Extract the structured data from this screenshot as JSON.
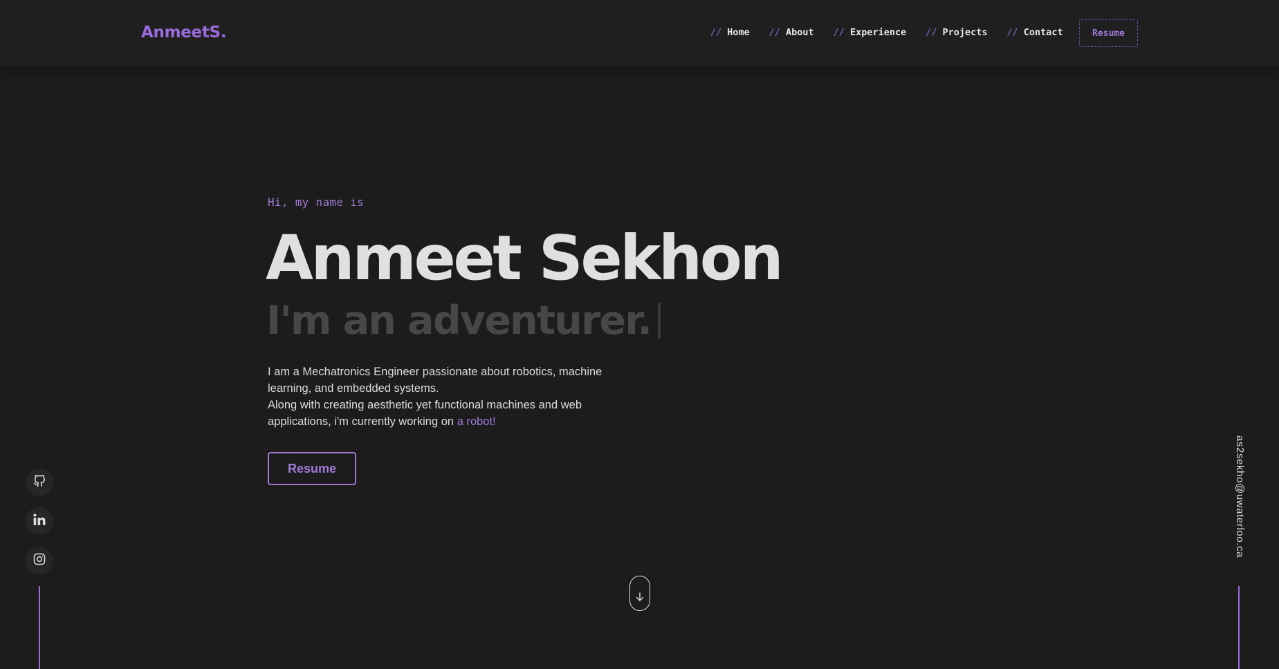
{
  "header": {
    "logo": "AnmeetS.",
    "nav": [
      {
        "slash": "//",
        "label": "Home"
      },
      {
        "slash": "//",
        "label": "About"
      },
      {
        "slash": "//",
        "label": "Experience"
      },
      {
        "slash": "//",
        "label": "Projects"
      },
      {
        "slash": "//",
        "label": "Contact"
      }
    ],
    "resume_label": "Resume"
  },
  "hero": {
    "greeting": "Hi, my name is",
    "name": "Anmeet Sekhon",
    "tagline": "I'm an adventurer.",
    "bio_line1": "I am a Mechatronics Engineer passionate about robotics, machine learning, and embedded systems.",
    "bio_line2": "Along with creating aesthetic yet functional machines and web applications, i'm currently working on",
    "bio_link": "a robot!",
    "resume_button": "Resume"
  },
  "socials": [
    {
      "name": "github-icon"
    },
    {
      "name": "linkedin-icon"
    },
    {
      "name": "instagram-icon"
    }
  ],
  "email": "as2sekho@uwaterloo.ca",
  "scroll_icon": "arrow-down-icon",
  "colors": {
    "background": "#1c1c1d",
    "header": "#1f1f20",
    "accent": "#9b6bdc",
    "accent_soft": "#a07ad6",
    "text": "#e0e0e0",
    "muted": "#474747"
  }
}
